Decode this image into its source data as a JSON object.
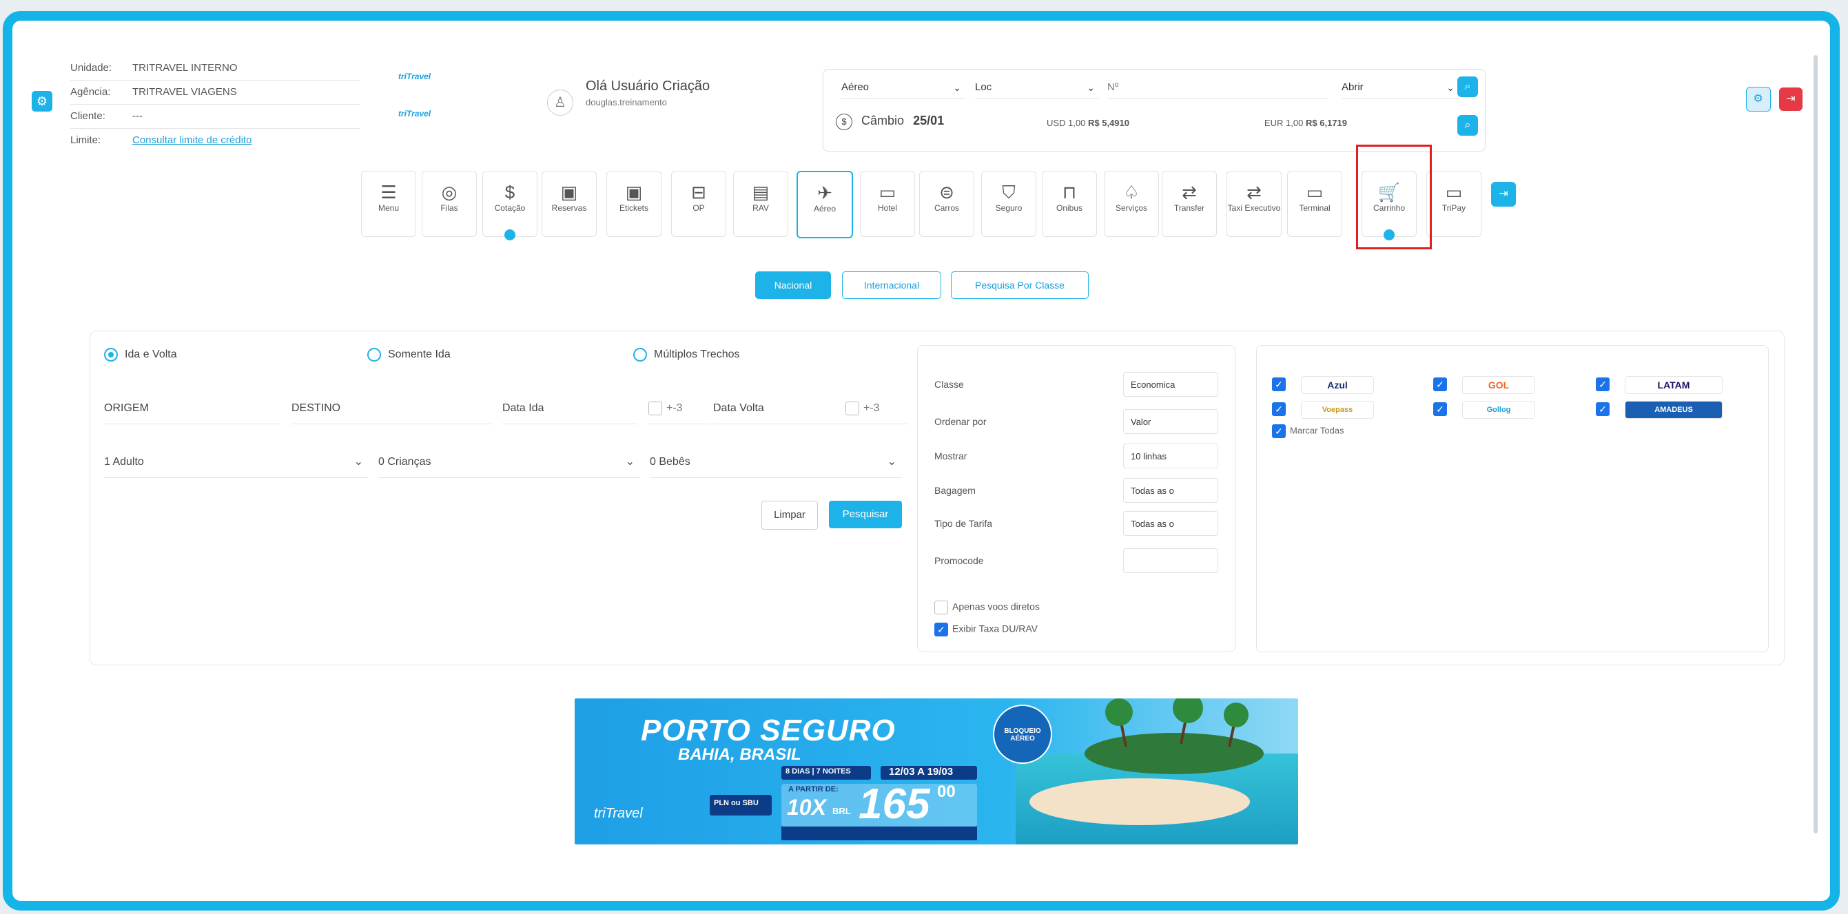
{
  "header": {
    "unidade_label": "Unidade:",
    "unidade_value": "TRITRAVEL INTERNO",
    "agencia_label": "Agência:",
    "agencia_value": "TRITRAVEL VIAGENS",
    "cliente_label": "Cliente:",
    "cliente_value": "---",
    "limite_label": "Limite:",
    "limite_link": "Consultar limite de crédito",
    "logo_text": "triTravel",
    "greeting": "Olá Usuário Criação",
    "username": "douglas.treinamento"
  },
  "quick_search": {
    "type_value": "Aéreo",
    "loc_value": "Loc",
    "number_placeholder": "Nº",
    "action_value": "Abrir",
    "cambio_label": "Câmbio",
    "cambio_date": "25/01",
    "usd_label": "USD 1,00",
    "usd_value": "R$ 5,4910",
    "eur_label": "EUR 1,00",
    "eur_value": "R$ 6,1719"
  },
  "nav": [
    {
      "icon": "☰",
      "label": "Menu"
    },
    {
      "icon": "◎",
      "label": "Filas"
    },
    {
      "icon": "$",
      "label": "Cotação"
    },
    {
      "icon": "▣",
      "label": "Reservas"
    },
    {
      "icon": "▣",
      "label": "Etickets"
    },
    {
      "icon": "⊟",
      "label": "OP"
    },
    {
      "icon": "▤",
      "label": "RAV"
    },
    {
      "icon": "✈",
      "label": "Aéreo"
    },
    {
      "icon": "▭",
      "label": "Hotel"
    },
    {
      "icon": "⊜",
      "label": "Carros"
    },
    {
      "icon": "⛉",
      "label": "Seguro"
    },
    {
      "icon": "⊓",
      "label": "Onibus"
    },
    {
      "icon": "♤",
      "label": "Serviços"
    },
    {
      "icon": "⇄",
      "label": "Transfer"
    },
    {
      "icon": "⇄",
      "label": "Taxi Executivo"
    },
    {
      "icon": "▭",
      "label": "Terminal"
    },
    {
      "icon": "🛒",
      "label": "Carrinho"
    },
    {
      "icon": "▭",
      "label": "TriPay"
    }
  ],
  "search_tabs": [
    "Nacional",
    "Internacional",
    "Pesquisa Por Classe"
  ],
  "trip_types": [
    "Ida e Volta",
    "Somente Ida",
    "Múltiplos Trechos"
  ],
  "fields": {
    "origem": "ORIGEM",
    "destino": "DESTINO",
    "data_ida": "Data Ida",
    "data_volta": "Data Volta",
    "flex_label": "+-3",
    "adultos": "1 Adulto",
    "criancas": "0 Crianças",
    "bebes": "0 Bebês"
  },
  "buttons": {
    "limpar": "Limpar",
    "pesquisar": "Pesquisar"
  },
  "filters": {
    "classe_label": "Classe",
    "classe_value": "Economica",
    "ordenar_label": "Ordenar por",
    "ordenar_value": "Valor",
    "mostrar_label": "Mostrar",
    "mostrar_value": "10 linhas",
    "bagagem_label": "Bagagem",
    "bagagem_value": "Todas as o",
    "tarifa_label": "Tipo de Tarifa",
    "tarifa_value": "Todas as o",
    "promocode_label": "Promocode",
    "apenas_diretos": "Apenas voos diretos",
    "exibir_taxa": "Exibir Taxa DU/RAV"
  },
  "airlines": [
    "Azul",
    "GOL",
    "LATAM",
    "Voepass",
    "Gollog",
    "AMADEUS"
  ],
  "marcar_todas": "Marcar Todas",
  "banner": {
    "title": "PORTO SEGURO",
    "subtitle": "BAHIA, BRASIL",
    "days": "8 DIAS | 7 NOITES",
    "dates": "12/03 A 19/03",
    "seal": "BLOQUEIO AÉREO",
    "from_label": "A PARTIR DE:",
    "installments": "10X",
    "currency": "BRL",
    "price": "165",
    "cents": "00",
    "origin": "PLN ou SBU",
    "brand": "triTravel"
  },
  "colors": {
    "accent": "#1db3e8",
    "highlight": "#e02020",
    "checkbox": "#1a73e8"
  }
}
